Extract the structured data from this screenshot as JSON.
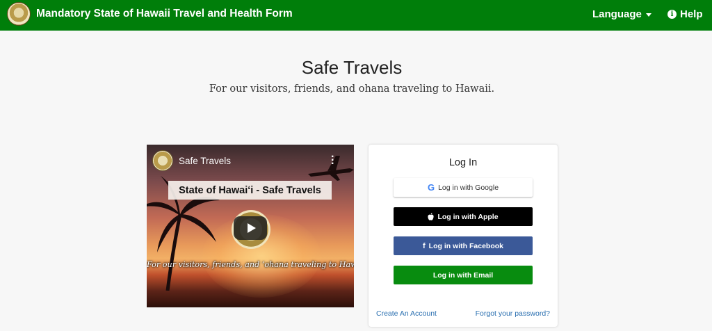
{
  "header": {
    "title": "Mandatory State of Hawaii Travel and Health Form",
    "language_label": "Language",
    "help_label": "Help"
  },
  "page": {
    "title": "Safe Travels",
    "subtitle": "For our visitors, friends, and ohana traveling to Hawaii."
  },
  "video": {
    "channel_name": "Safe Travels",
    "banner_text": "State of Hawaiʻi - Safe Travels",
    "caption": "For our visitors, friends, and ʻohana traveling to Hawaiʻi."
  },
  "login": {
    "title": "Log In",
    "google_label": "Log in with Google",
    "apple_label": "Log in with Apple",
    "facebook_label": "Log in with Facebook",
    "email_label": "Log in with Email",
    "create_account": "Create An Account",
    "forgot_password": "Forgot your password?"
  },
  "colors": {
    "header_green": "#007e0a",
    "facebook_blue": "#3b5998",
    "email_green": "#088c0f",
    "link_blue": "#2a6fb0"
  },
  "icons": [
    "hawaii-seal-icon",
    "caret-down-icon",
    "info-icon",
    "play-icon",
    "more-vert-icon",
    "google-icon",
    "apple-icon",
    "facebook-icon"
  ]
}
